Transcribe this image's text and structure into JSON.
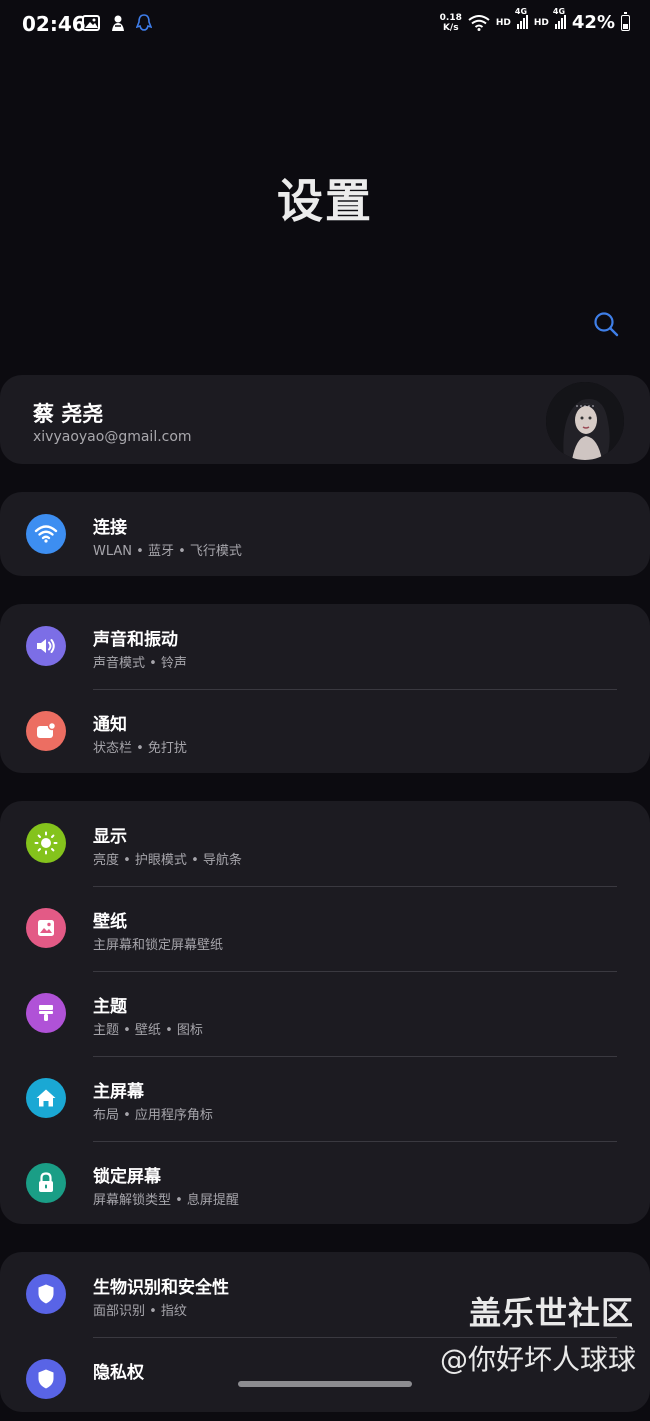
{
  "status_bar": {
    "time": "02:46",
    "net_speed_value": "0.18",
    "net_speed_unit": "K/s",
    "hd1": "HD",
    "hd2": "HD",
    "net_type": "4G",
    "battery_text": "42%",
    "battery_level": 0.42
  },
  "page": {
    "title": "设置",
    "search_icon": "search-icon"
  },
  "profile": {
    "name": "蔡 尧尧",
    "email": "xivyaoyao@gmail.com"
  },
  "groups": [
    {
      "items": [
        {
          "title": "连接",
          "subtitle": "WLAN • 蓝牙 • 飞行模式",
          "icon": "wifi-icon",
          "color": "#3d8ef1"
        }
      ]
    },
    {
      "items": [
        {
          "title": "声音和振动",
          "subtitle": "声音模式 • 铃声",
          "icon": "volume-icon",
          "color": "#7c6ee6"
        },
        {
          "title": "通知",
          "subtitle": "状态栏 • 免打扰",
          "icon": "notification-icon",
          "color": "#ec6e62"
        }
      ]
    },
    {
      "items": [
        {
          "title": "显示",
          "subtitle": "亮度 • 护眼模式 • 导航条",
          "icon": "sun-icon",
          "color": "#84c31c"
        },
        {
          "title": "壁纸",
          "subtitle": "主屏幕和锁定屏幕壁纸",
          "icon": "wallpaper-icon",
          "color": "#e35a86"
        },
        {
          "title": "主题",
          "subtitle": "主题 • 壁纸 • 图标",
          "icon": "theme-brush-icon",
          "color": "#b052d7"
        },
        {
          "title": "主屏幕",
          "subtitle": "布局 • 应用程序角标",
          "icon": "home-icon",
          "color": "#1aa8d4"
        },
        {
          "title": "锁定屏幕",
          "subtitle": "屏幕解锁类型 • 息屏提醒",
          "icon": "lock-icon",
          "color": "#1a9e86"
        }
      ]
    },
    {
      "items": [
        {
          "title": "生物识别和安全性",
          "subtitle": "面部识别 • 指纹",
          "icon": "shield-icon",
          "color": "#5964e6"
        },
        {
          "title": "隐私权",
          "subtitle": "",
          "icon": "shield-icon",
          "color": "#5964e6"
        }
      ]
    }
  ],
  "watermark": {
    "line1": "盖乐世社区",
    "line2": "@你好坏人球球"
  }
}
